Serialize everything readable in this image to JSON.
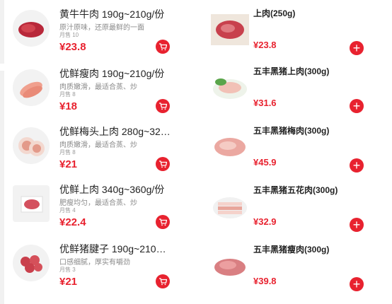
{
  "currency": "¥",
  "left_products": [
    {
      "name": "黄牛牛肉 190g~210g/份",
      "desc": "原汁原味，还原最鲜的一面",
      "sold": "月售 10",
      "price": "23.8"
    },
    {
      "name": "优鲜瘦肉 190g~210g/份",
      "desc": "肉质嫩滑，最适合蒸、炒",
      "sold": "月售 8",
      "price": "18"
    },
    {
      "name": "优鲜梅头上肉 280g~32…",
      "desc": "肉质嫩滑，最适合蒸、炒",
      "sold": "月售 8",
      "price": "21"
    },
    {
      "name": "优鲜上肉 340g~360g/份",
      "desc": "肥瘦均匀，最适合蒸、炒",
      "sold": "月售 4",
      "price": "22.4"
    },
    {
      "name": "优鲜猪腱子 190g~210…",
      "desc": "口感细腻，厚实有嚼劲",
      "sold": "月售 3",
      "price": "21"
    }
  ],
  "right_products": [
    {
      "name": "上肉(250g)",
      "price": "23.8"
    },
    {
      "name": "五丰黑猪上肉(300g)",
      "price": "31.6"
    },
    {
      "name": "五丰黑猪梅肉(300g)",
      "price": "45.9"
    },
    {
      "name": "五丰黑猪五花肉(300g)",
      "price": "32.9"
    },
    {
      "name": "五丰黑猪瘦肉(300g)",
      "price": "39.8"
    }
  ],
  "icons": {
    "cart": "cart-icon",
    "add": "plus-icon"
  },
  "colors": {
    "accent": "#e8222f"
  }
}
